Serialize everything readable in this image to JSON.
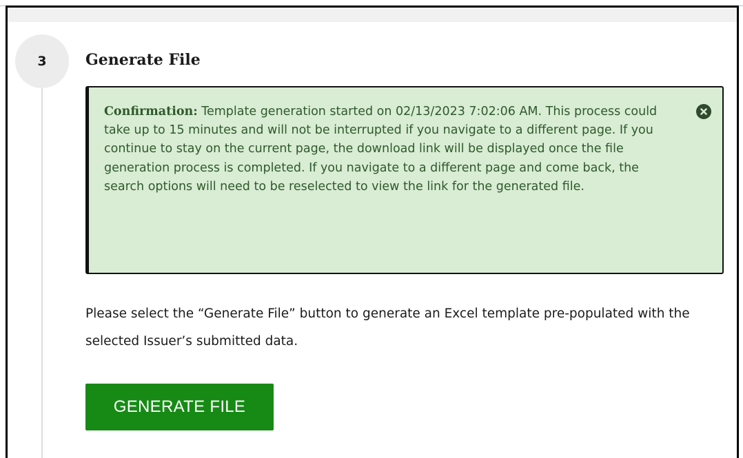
{
  "step": {
    "number": "3",
    "title": "Generate File"
  },
  "alert": {
    "label": "Confirmation:",
    "message": " Template generation started on 02/13/2023 7:02:06 AM. This process could take up to 15 minutes and will not be interrupted if you navigate to a different page. If you continue to stay on the current page, the download link will be displayed once the file generation process is completed. If you navigate to a different page and come back, the search options will need to be reselected to view the link for the generated file.",
    "close_icon": "close-circle-icon"
  },
  "description": "Please select the “Generate File” button to generate an Excel template pre-populated with the selected Issuer’s submitted data.",
  "generate_button": {
    "label": "GENERATE FILE"
  },
  "colors": {
    "alert_background": "#d9ecd4",
    "alert_text": "#2e5a2b",
    "button_background": "#178a16"
  }
}
